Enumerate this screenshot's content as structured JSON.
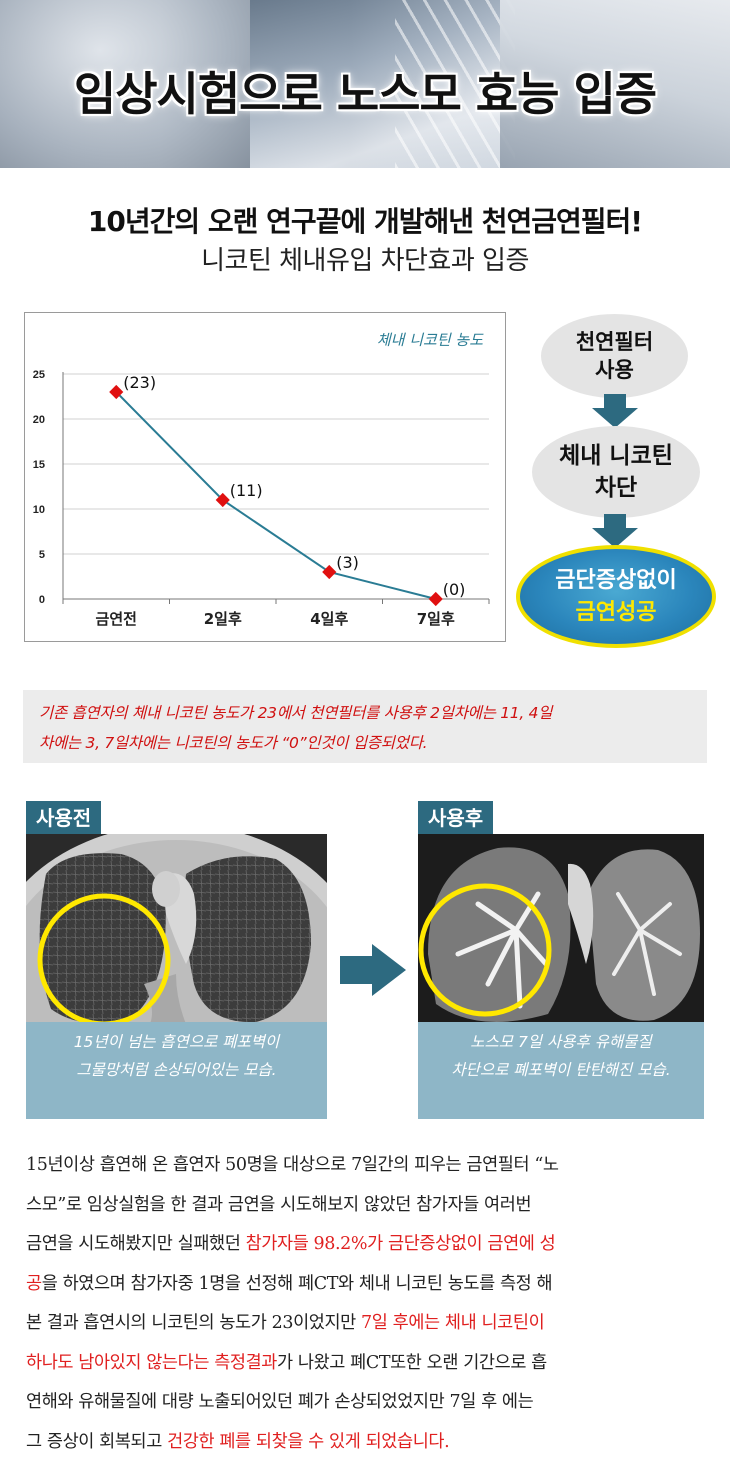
{
  "banner": {
    "title": "임상시험으로 노스모 효능 입증"
  },
  "headline": "10년간의 오랜 연구끝에 개발해낸 천연금연필터!",
  "subline": "니코틴 체내유입 차단효과 입증",
  "chart_data": {
    "type": "line",
    "title": "체내 니코틴 농도",
    "categories": [
      "금연전",
      "2일후",
      "4일후",
      "7일후"
    ],
    "values": [
      23,
      11,
      3,
      0
    ],
    "data_labels": [
      "(23)",
      "(11)",
      "(3)",
      "(0)"
    ],
    "y_ticks": [
      "0",
      "5",
      "10",
      "15",
      "20",
      "25"
    ],
    "ylim": [
      0,
      25
    ],
    "grid": true,
    "line_color": "#2a7c94",
    "marker_color": "#e01010"
  },
  "flow": {
    "step1": [
      "천연필터",
      "사용"
    ],
    "step2": [
      "체내 니코틴",
      "차단"
    ],
    "step3": [
      "금단증상없이",
      "금연성공"
    ],
    "arrow_color": "#2d6a80",
    "highlight_color": "#ffe800"
  },
  "statement": {
    "line1": "기존 흡연자의 체내 니코틴 농도가 23에서 천연필터를 사용후 2일차에는 11, 4일",
    "line2": "차에는 3, 7일차에는 니코틴의 농도가 “0”인것이 입증되었다."
  },
  "before": {
    "tag": "사용전",
    "caption_line1": "15년이 넘는 흡연으로 폐포벽이",
    "caption_line2": "그물망처럼 손상되어있는 모습."
  },
  "after": {
    "tag": "사용후",
    "caption_line1": "노스모 7일 사용후 유해물질",
    "caption_line2": "차단으로 폐포벽이 탄탄해진 모습."
  },
  "body": {
    "l1": "15년이상 흡연해 온 흡연자 50명을 대상으로 7일간의 피우는 금연필터 “노",
    "l2": "스모”로 임상실험을 한 결과 금연을 시도해보지 않았던 참가자들 여러번",
    "l3a": "금연을 시도해봤지만 실패했던 ",
    "l3b": "참가자들 98.2%가 금단증상없이 금연에 성",
    "l4a": "공",
    "l4b": "을 하였으며 참가자중 1명을 선정해 폐CT와 체내 니코틴 농도를 측정 해",
    "l5a": "본 결과 흡연시의 니코틴의 농도가 23이었지만 ",
    "l5b": "7일 후에는 체내 니코틴이",
    "l6a": "하나도 남아있지 않는다는 측정결과",
    "l6b": "가 나왔고 폐CT또한 오랜 기간으로 흡",
    "l7": "연해와 유해물질에 대량 노출되어있던 폐가 손상되었었지만 7일 후 에는",
    "l8a": "그 증상이 회복되고 ",
    "l8b": "건강한 폐를 되찾을 수 있게 되었습니다."
  }
}
